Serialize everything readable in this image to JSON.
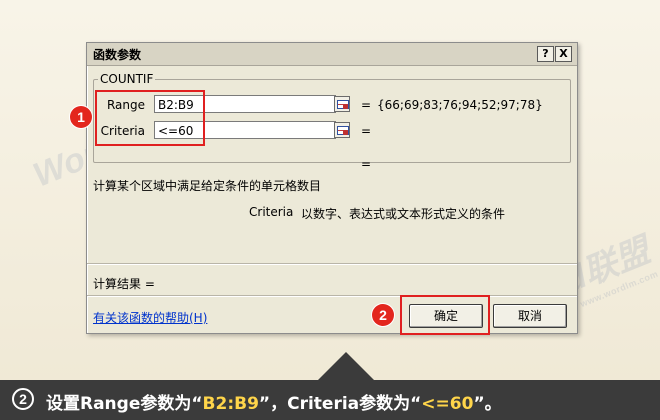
{
  "dialog": {
    "title": "函数参数",
    "help_btn": "?",
    "close_btn": "X",
    "function_name": "COUNTIF",
    "args": [
      {
        "label": "Range",
        "value": "B2:B9",
        "eq": "=",
        "result": "{66;69;83;76;94;52;97;78}"
      },
      {
        "label": "Criteria",
        "value": "<=60",
        "eq": "=",
        "result": ""
      }
    ],
    "func_result_eq": "=",
    "function_desc": "计算某个区域中满足给定条件的单元格数目",
    "arg_desc_name": "Criteria",
    "arg_desc_text": "以数字、表达式或文本形式定义的条件",
    "calc_result_label": "计算结果 =",
    "help_link": "有关该函数的帮助(H)",
    "ok_label": "确定",
    "cancel_label": "取消"
  },
  "callouts": {
    "one": "1",
    "two": "2"
  },
  "watermarks": {
    "brand": "Word联盟",
    "site": "www.wordlm.com"
  },
  "caption": {
    "num": "2",
    "part1": "设置Range参数为“",
    "val1": "B2:B9",
    "part2": "”，Criteria参数为“",
    "val2": "<=60",
    "part3": "”。"
  },
  "colors": {
    "accent_red": "#e3261d",
    "caption_bg": "#3b3b3b",
    "highlight": "#ffd54a",
    "link": "#0033cc"
  }
}
